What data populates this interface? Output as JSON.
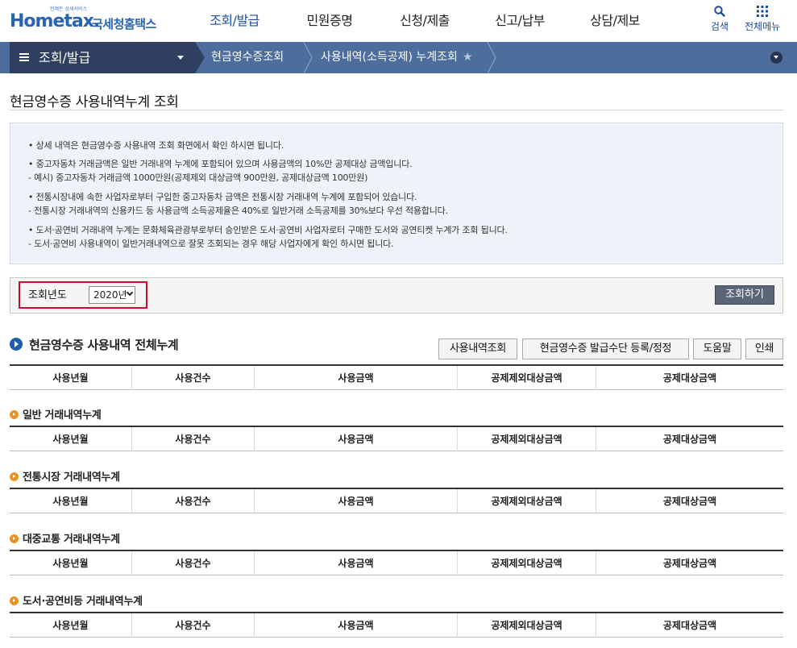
{
  "header": {
    "logo_small": "언제든 상세서비스",
    "logo_main": "Hometax.",
    "logo_kr": "국세청홈택스",
    "nav": [
      "조회/발급",
      "민원증명",
      "신청/제출",
      "신고/납부",
      "상담/제보"
    ],
    "search_label": "검색",
    "allmenu_label": "전체메뉴"
  },
  "locbar": {
    "home": "조회/발급",
    "items": [
      "현금영수증조회",
      "사용내역(소득공제) 누계조회"
    ]
  },
  "page_title": "현금영수증 사용내역누계 조회",
  "info": [
    "• 상세 내역은 현금영수증 사용내역 조회 화면에서 확인 하시면 됩니다.",
    "• 중고자동차 거래금액은 일반 거래내역 누계에 포함되어 있으며 사용금액의 10%만 공제대상 금액입니다.",
    " - 예시) 중고자동차 거래금액 1000만원(공제제외 대상금액 900만원, 공제대상금액 100만원)",
    "• 전통시장내에 속한 사업자로부터 구입한 중고자동차 금액은 전통시장 거래내역 누계에 포함되어 있습니다.",
    " - 전통시장 거래내역의 신용카드 등 사용금액 소득공제율은 40%로 일반거래 소득공제를 30%보다 우선 적용합니다.",
    "• 도서·공연비 거래내역 누계는 문화체육관광부로부터 승인받은 도서·공연비 사업자로터 구매한 도서와 공연티켓 누계가 조회 됩니다.",
    " - 도서·공연비 사용내역이 일반거래내역으로 잘못 조회되는 경우 해당 사업자에게 확인 하시면 됩니다."
  ],
  "search": {
    "label": "조회년도",
    "year": "2020년",
    "button": "조회하기"
  },
  "summary": {
    "title": "현금영수증 사용내역 전체누계",
    "buttons": [
      "사용내역조회",
      "현금영수증 발급수단 등록/정정",
      "도움말",
      "인쇄"
    ]
  },
  "columns": [
    "사용년월",
    "사용건수",
    "사용금액",
    "공제제외대상금액",
    "공제대상금액"
  ],
  "sections": [
    "일반 거래내역누계",
    "전통시장 거래내역누계",
    "대중교통 거래내역누계",
    "도서·공연비등 거래내역누계"
  ],
  "colors": {
    "brand": "#2864b4",
    "locbar": "#4d6d9c",
    "locbar_dark": "#2e3f60",
    "highlight": "#c8102e",
    "bullet_orange": "#e89422"
  }
}
